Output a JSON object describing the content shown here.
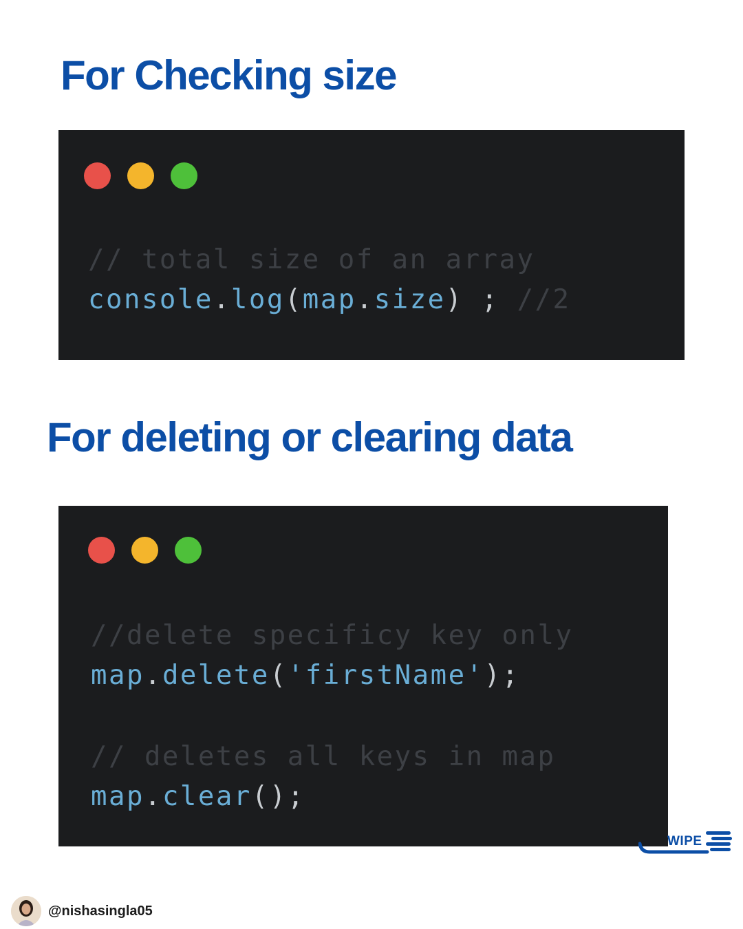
{
  "sections": [
    {
      "heading": "For Checking size",
      "lines": [
        [
          {
            "t": "// total size of an array",
            "c": "cm"
          }
        ],
        [
          {
            "t": "console",
            "c": "fn"
          },
          {
            "t": ".",
            "c": "pn"
          },
          {
            "t": "log",
            "c": "fn"
          },
          {
            "t": "(",
            "c": "pn"
          },
          {
            "t": "map",
            "c": "fn"
          },
          {
            "t": ".",
            "c": "pn"
          },
          {
            "t": "size",
            "c": "fn"
          },
          {
            "t": ") ; ",
            "c": "pn"
          },
          {
            "t": "//2",
            "c": "cm"
          }
        ]
      ]
    },
    {
      "heading": "For deleting or clearing data",
      "lines": [
        [
          {
            "t": "//delete specificy key only",
            "c": "cm"
          }
        ],
        [
          {
            "t": "map",
            "c": "fn"
          },
          {
            "t": ".",
            "c": "pn"
          },
          {
            "t": "delete",
            "c": "fn"
          },
          {
            "t": "(",
            "c": "pn"
          },
          {
            "t": "'firstName'",
            "c": "st"
          },
          {
            "t": ");",
            "c": "pn"
          }
        ],
        [],
        [
          {
            "t": "// deletes all keys in map",
            "c": "cm"
          }
        ],
        [
          {
            "t": "map",
            "c": "fn"
          },
          {
            "t": ".",
            "c": "pn"
          },
          {
            "t": "clear",
            "c": "fn"
          },
          {
            "t": "();",
            "c": "pn"
          }
        ]
      ]
    }
  ],
  "swipe": {
    "label": "WIPE"
  },
  "footer": {
    "handle": "@nishasingla05"
  },
  "colors": {
    "heading": "#0c4ea6",
    "code_bg": "#1b1c1e",
    "dot_red": "#e8514a",
    "dot_yellow": "#f4b52c",
    "dot_green": "#4ec03a",
    "comment": "#3d4045",
    "identifier": "#6aaed6",
    "punctuation": "#c9cdd1"
  },
  "icons": [
    "window-dot-red",
    "window-dot-yellow",
    "window-dot-green",
    "swipe-arrow-icon",
    "avatar"
  ]
}
